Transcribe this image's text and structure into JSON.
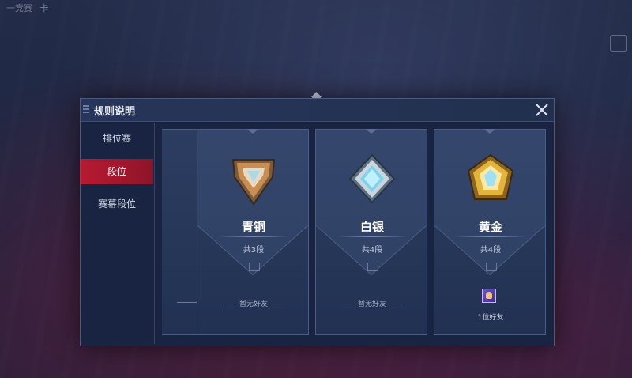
{
  "background": {
    "top_left_text": [
      "一竞赛",
      "卡"
    ]
  },
  "dialog": {
    "title": "规则说明",
    "close_icon": "close-icon",
    "sidebar": {
      "items": [
        {
          "label": "排位赛",
          "active": false
        },
        {
          "label": "段位",
          "active": true
        },
        {
          "label": "赛幕段位",
          "active": false
        }
      ]
    },
    "ranks": [
      {
        "name": "青铜",
        "count": "共3段",
        "friends": "暂无好友",
        "badge": "bronze-badge-icon",
        "color": "#c98f52"
      },
      {
        "name": "白银",
        "count": "共4段",
        "friends": "暂无好友",
        "badge": "silver-badge-icon",
        "color": "#9ad7e6"
      },
      {
        "name": "黄金",
        "count": "共4段",
        "friends": "1位好友",
        "badge": "gold-badge-icon",
        "color": "#e4b43a"
      }
    ]
  },
  "colors": {
    "accent_red": "#b81a32",
    "panel_bg": "#192443",
    "card_border": "#4a5d86"
  }
}
